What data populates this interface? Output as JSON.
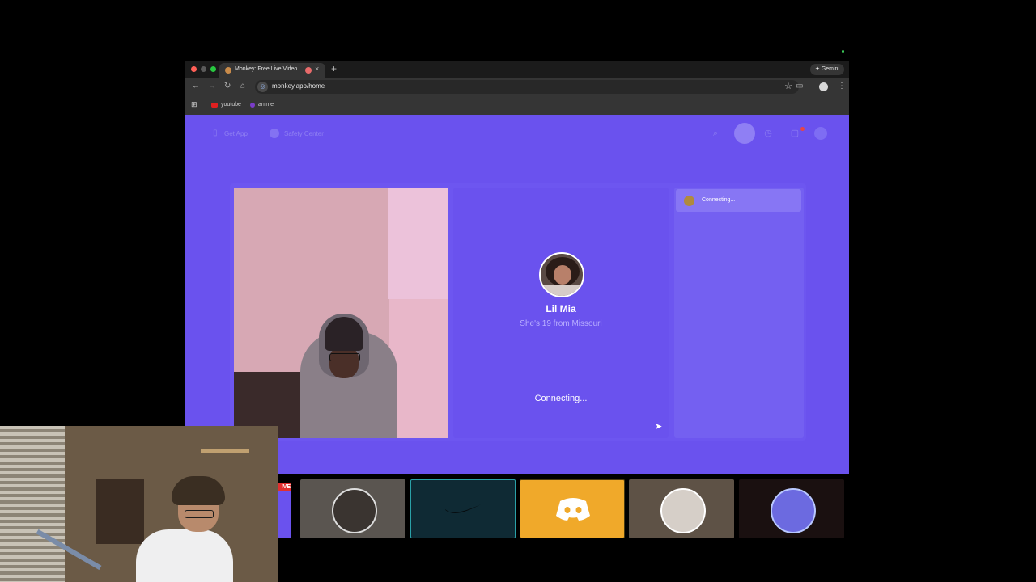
{
  "browser": {
    "tab_title": "Monkey: Free Live Video ...",
    "tab_close": "×",
    "new_tab": "+",
    "gemini_label": "✦ Gemini",
    "url": "monkey.app/home",
    "star": "☆",
    "bookmarks": [
      {
        "label": "youtube"
      },
      {
        "label": "anime"
      }
    ]
  },
  "site": {
    "nav": {
      "get_app": "Get App",
      "safety_center": "Safety Center"
    },
    "match": {
      "name": "Lil Mia",
      "subtitle": "She's 19 from Missouri",
      "status": "Connecting..."
    },
    "chat": {
      "status": "Connecting..."
    }
  },
  "stream": {
    "live_label": "IVE",
    "tiles": [
      {
        "name": "friend-photo",
        "bg": "#5a5550"
      },
      {
        "name": "nike-logo",
        "bg": "#0f2a34",
        "border": "#2aa1a8"
      },
      {
        "name": "discord-logo",
        "bg": "#f0a92a",
        "border": "#4a3a10"
      },
      {
        "name": "two-men-photo",
        "bg": "#5e5246"
      },
      {
        "name": "monkey-mascot",
        "bg": "#1a1010"
      }
    ]
  },
  "colors": {
    "brand_purple": "#6a52ee",
    "discord_tile": "#f0a92a"
  }
}
